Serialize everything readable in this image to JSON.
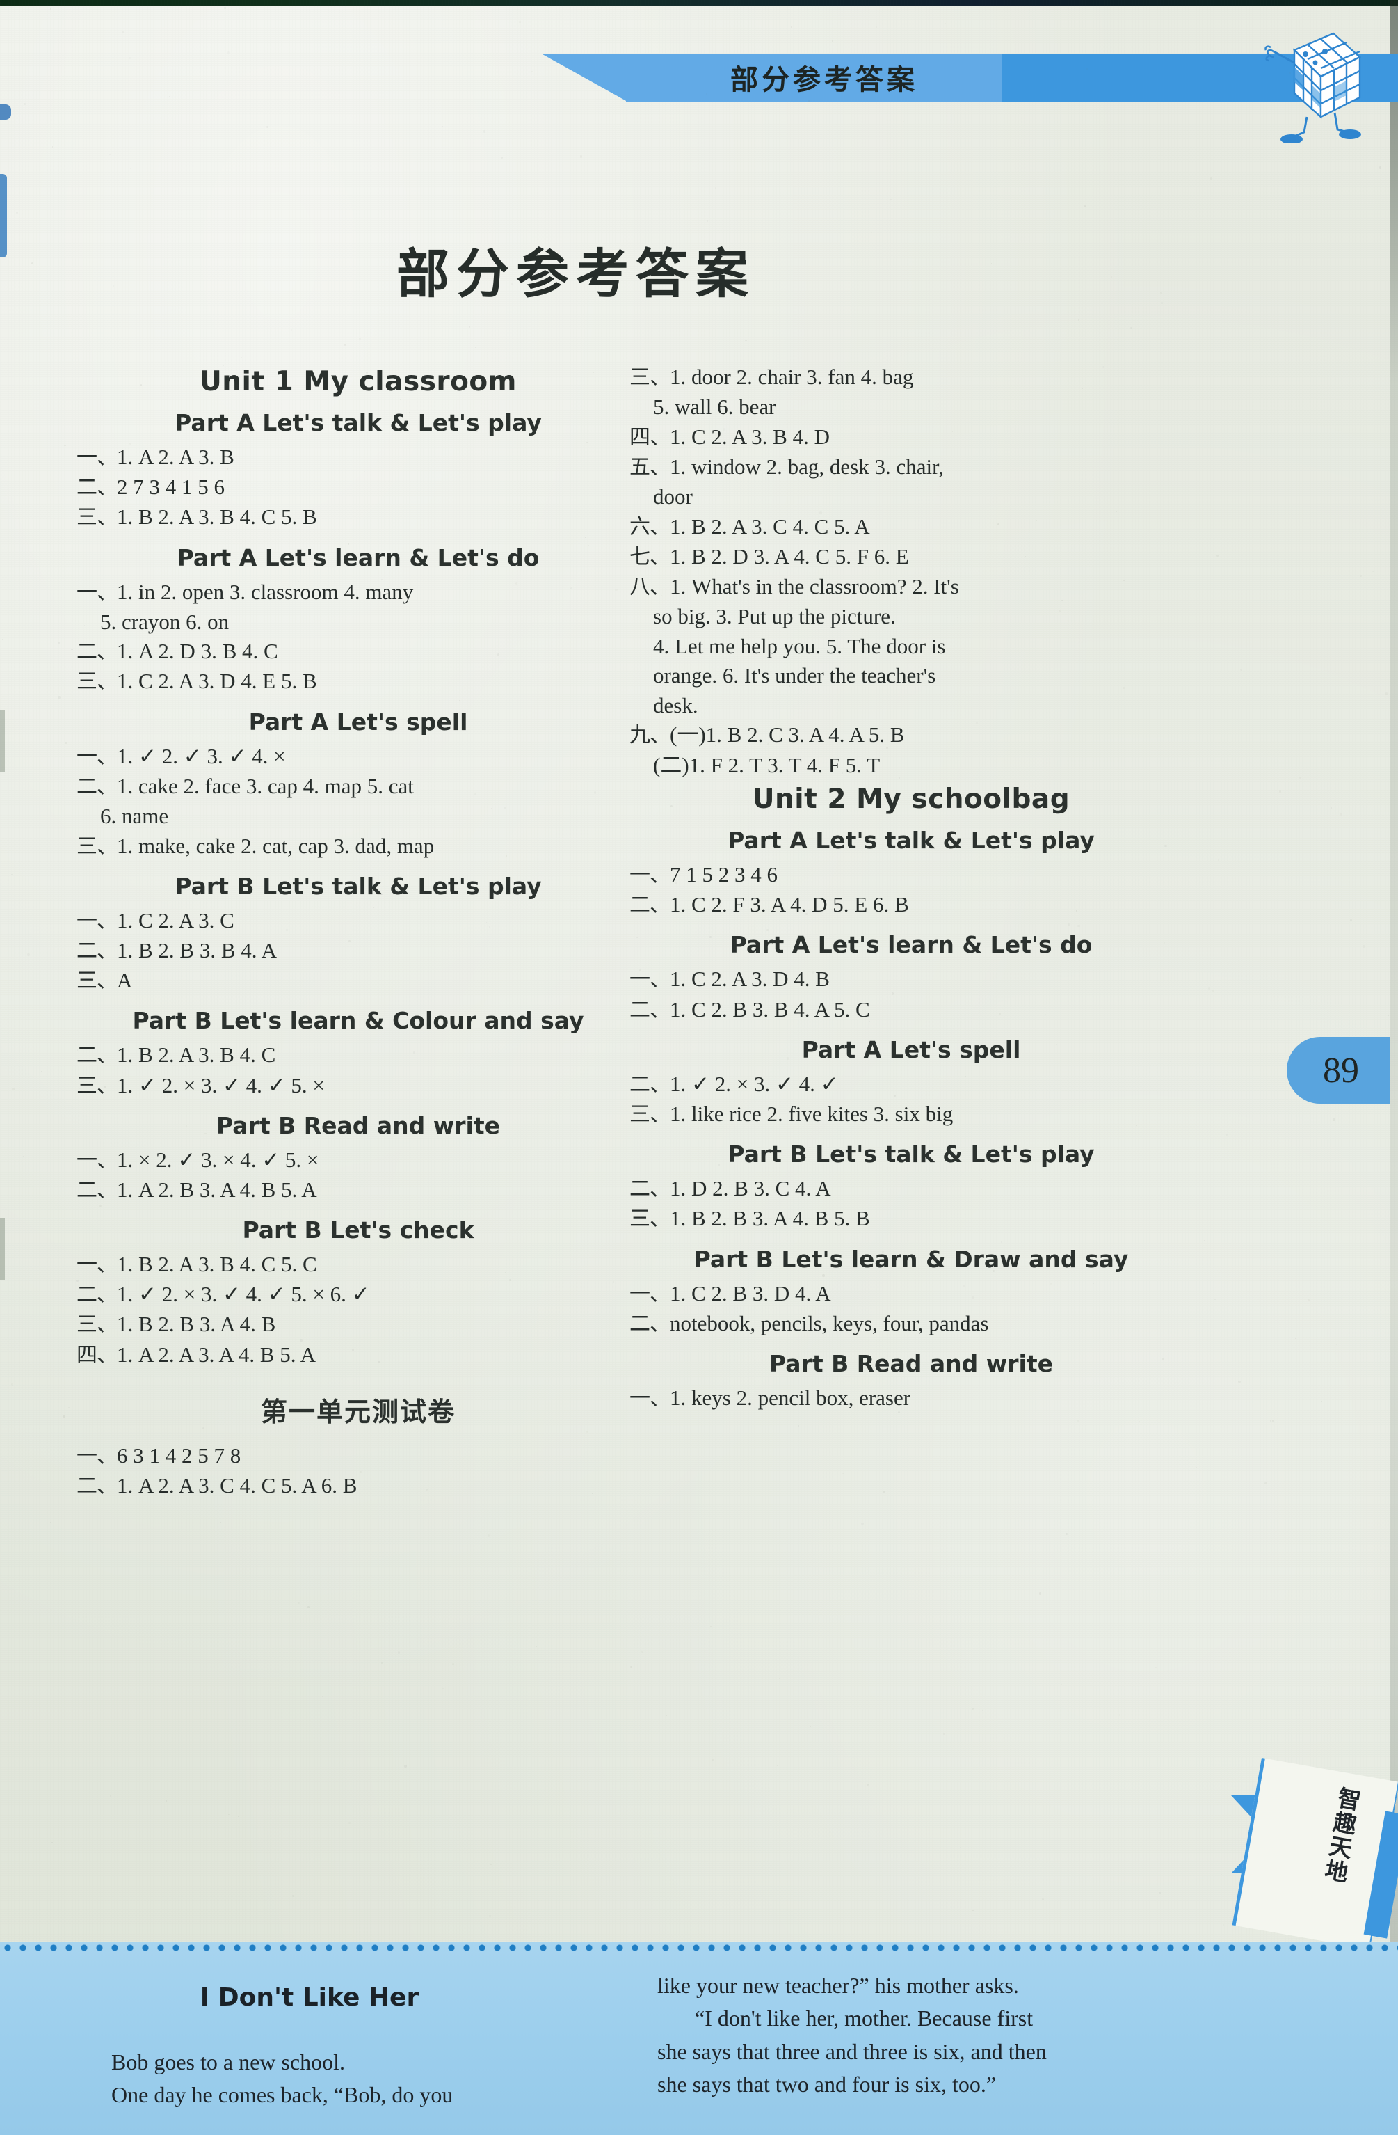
{
  "header": {
    "banner_title": "部分参考答案",
    "mascot": "rubiks-cube-mascot"
  },
  "page_title": "部分参考答案",
  "page_number": "89",
  "corner_flag": "智趣天地",
  "left_column": [
    {
      "kind": "unit",
      "text": "Unit 1   My classroom"
    },
    {
      "kind": "part",
      "text": "Part A   Let's talk & Let's play"
    },
    {
      "kind": "ans",
      "cn": "一、",
      "text": "1. A   2. A   3. B"
    },
    {
      "kind": "ans",
      "cn": "二、",
      "text": "2  7  3  4  1  5  6"
    },
    {
      "kind": "ans",
      "cn": "三、",
      "text": "1. B   2. A   3. B   4. C   5. B"
    },
    {
      "kind": "part",
      "text": "Part A   Let's learn & Let's do"
    },
    {
      "kind": "ans",
      "cn": "一、",
      "text": "1. in   2. open   3. classroom   4. many"
    },
    {
      "kind": "ans",
      "cn": "",
      "text": "5. crayon   6. on",
      "indent": true
    },
    {
      "kind": "ans",
      "cn": "二、",
      "text": "1. A   2. D   3. B   4. C"
    },
    {
      "kind": "ans",
      "cn": "三、",
      "text": "1. C   2. A   3. D   4. E   5. B"
    },
    {
      "kind": "part",
      "text": "Part A   Let's spell"
    },
    {
      "kind": "ans",
      "cn": "一、",
      "text": "1. ✓   2. ✓   3. ✓   4. ×"
    },
    {
      "kind": "ans",
      "cn": "二、",
      "text": "1. cake   2. face   3. cap   4. map   5. cat"
    },
    {
      "kind": "ans",
      "cn": "",
      "text": "6. name",
      "indent": true
    },
    {
      "kind": "ans",
      "cn": "三、",
      "text": "1. make, cake   2. cat, cap   3. dad, map"
    },
    {
      "kind": "part",
      "text": "Part B   Let's talk & Let's play"
    },
    {
      "kind": "ans",
      "cn": "一、",
      "text": "1. C   2. A   3. C"
    },
    {
      "kind": "ans",
      "cn": "二、",
      "text": "1. B   2. B   3. B   4. A"
    },
    {
      "kind": "ans",
      "cn": "三、",
      "text": "A"
    },
    {
      "kind": "part",
      "text": "Part B   Let's learn & Colour and say"
    },
    {
      "kind": "ans",
      "cn": "二、",
      "text": "1. B   2. A   3. B   4. C"
    },
    {
      "kind": "ans",
      "cn": "三、",
      "text": "1. ✓   2. ×   3. ✓   4. ✓   5. ×"
    },
    {
      "kind": "part",
      "text": "Part B   Read and write"
    },
    {
      "kind": "ans",
      "cn": "一、",
      "text": "1. ×   2. ✓   3. ×   4. ✓   5. ×"
    },
    {
      "kind": "ans",
      "cn": "二、",
      "text": "1. A   2. B   3. A   4. B   5. A"
    },
    {
      "kind": "part",
      "text": "Part B   Let's check"
    },
    {
      "kind": "ans",
      "cn": "一、",
      "text": "1. B   2. A   3. B   4. C   5. C"
    },
    {
      "kind": "ans",
      "cn": "二、",
      "text": "1. ✓   2. ×   3. ✓   4. ✓   5. ×   6. ✓"
    },
    {
      "kind": "ans",
      "cn": "三、",
      "text": "1. B   2. B   3. A   4. B"
    },
    {
      "kind": "ans",
      "cn": "四、",
      "text": "1. A   2. A   3. A   4. B   5. A"
    },
    {
      "kind": "cn_section",
      "text": "第一单元测试卷"
    },
    {
      "kind": "ans",
      "cn": "一、",
      "text": "6  3  1  4  2  5  7  8"
    },
    {
      "kind": "ans",
      "cn": "二、",
      "text": "1. A   2. A   3. C   4. C   5. A   6. B"
    }
  ],
  "right_column": [
    {
      "kind": "ans",
      "cn": "三、",
      "text": "1. door   2. chair   3. fan   4. bag"
    },
    {
      "kind": "ans",
      "cn": "",
      "text": "5. wall   6. bear",
      "indent": true
    },
    {
      "kind": "ans",
      "cn": "四、",
      "text": "1. C   2. A   3. B   4. D"
    },
    {
      "kind": "ans",
      "cn": "五、",
      "text": "1. window   2. bag, desk   3. chair,"
    },
    {
      "kind": "ans",
      "cn": "",
      "text": "door",
      "indent": true
    },
    {
      "kind": "ans",
      "cn": "六、",
      "text": "1. B   2. A   3. C   4. C   5. A"
    },
    {
      "kind": "ans",
      "cn": "七、",
      "text": "1. B   2. D   3. A   4. C   5. F   6. E"
    },
    {
      "kind": "ans",
      "cn": "八、",
      "text": "1. What's in the classroom?    2. It's"
    },
    {
      "kind": "ans",
      "cn": "",
      "text": "so big.   3. Put up the picture.",
      "indent": true
    },
    {
      "kind": "ans",
      "cn": "",
      "text": "4. Let me help you.    5. The door is",
      "indent": true
    },
    {
      "kind": "ans",
      "cn": "",
      "text": "orange.    6. It's under the teacher's",
      "indent": true
    },
    {
      "kind": "ans",
      "cn": "",
      "text": "desk.",
      "indent": true
    },
    {
      "kind": "ans",
      "cn": "九、",
      "text": "(一)1. B   2. C   3. A   4. A   5. B"
    },
    {
      "kind": "ans",
      "cn": "",
      "text": "(二)1. F   2. T   3. T   4. F   5. T",
      "indent": true
    },
    {
      "kind": "unit",
      "text": "Unit 2   My schoolbag"
    },
    {
      "kind": "part",
      "text": "Part A   Let's talk & Let's play"
    },
    {
      "kind": "ans",
      "cn": "一、",
      "text": "7  1  5  2  3  4  6"
    },
    {
      "kind": "ans",
      "cn": "二、",
      "text": "1. C   2. F   3. A   4. D   5. E   6. B"
    },
    {
      "kind": "part",
      "text": "Part A   Let's learn & Let's do"
    },
    {
      "kind": "ans",
      "cn": "一、",
      "text": "1. C   2. A   3. D   4. B"
    },
    {
      "kind": "ans",
      "cn": "二、",
      "text": "1. C   2. B   3. B   4. A   5. C"
    },
    {
      "kind": "part",
      "text": "Part A   Let's spell"
    },
    {
      "kind": "ans",
      "cn": "二、",
      "text": "1. ✓   2. ×   3. ✓   4. ✓"
    },
    {
      "kind": "ans",
      "cn": "三、",
      "text": "1. like rice   2. five kites   3. six big"
    },
    {
      "kind": "part",
      "text": "Part B   Let's talk & Let's play"
    },
    {
      "kind": "ans",
      "cn": "二、",
      "text": "1. D   2. B   3. C   4. A"
    },
    {
      "kind": "ans",
      "cn": "三、",
      "text": "1. B   2. B   3. A   4. B   5. B"
    },
    {
      "kind": "part",
      "text": "Part B   Let's learn & Draw and say"
    },
    {
      "kind": "ans",
      "cn": "一、",
      "text": "1. C   2. B   3. D   4. A"
    },
    {
      "kind": "ans",
      "cn": "二、",
      "text": "notebook, pencils, keys, four, pandas"
    },
    {
      "kind": "part",
      "text": "Part B   Read and write"
    },
    {
      "kind": "ans",
      "cn": "一、",
      "text": "1. keys   2. pencil box, eraser"
    }
  ],
  "story": {
    "title": "I Don't Like Her",
    "left_lines": [
      "Bob goes to a new school.",
      "One day he comes back, “Bob, do you"
    ],
    "right_lines": [
      "like your new teacher?” his mother asks.",
      "“I don't like her, mother. Because first",
      "she says that three and three is six, and then",
      "she says that two and four is six, too.”"
    ]
  }
}
